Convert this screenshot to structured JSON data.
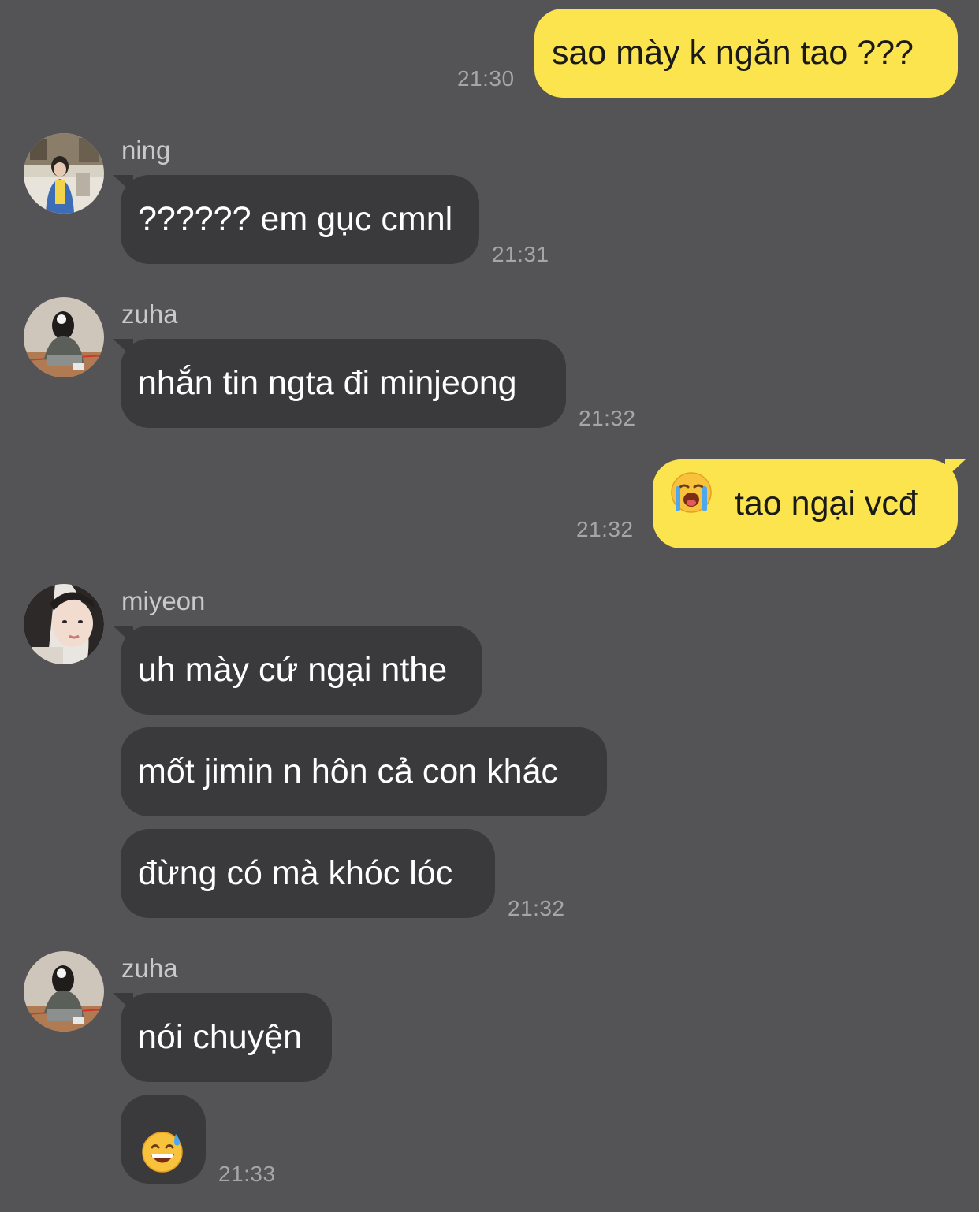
{
  "messages": [
    {
      "sender": "me",
      "text": "sao mày k ngăn tao ???",
      "time": "21:30"
    },
    {
      "sender": "ning",
      "text": "?????? em gục cmnl",
      "time": "21:31"
    },
    {
      "sender": "zuha",
      "text": "nhắn tin ngta đi minjeong",
      "time": "21:32"
    },
    {
      "sender": "me",
      "emoji": "loudly-crying-face",
      "text": "tao ngại vcđ",
      "time": "21:32"
    },
    {
      "sender": "miyeon",
      "text": "uh mày cứ ngại nthe"
    },
    {
      "sender": "miyeon",
      "text": "mốt jimin n hôn cả con khác"
    },
    {
      "sender": "miyeon",
      "text": "đừng có mà khóc lóc",
      "time": "21:32"
    },
    {
      "sender": "zuha",
      "text": "nói chuyện"
    },
    {
      "sender": "zuha",
      "emoji": "grinning-face-with-sweat",
      "time": "21:33"
    }
  ],
  "senders": {
    "ning": "ning",
    "zuha": "zuha",
    "miyeon": "miyeon"
  },
  "colors": {
    "background": "#545355",
    "my_bubble": "#fbe44e",
    "other_bubble": "#3a393c",
    "timestamp": "#a6a5a8"
  }
}
